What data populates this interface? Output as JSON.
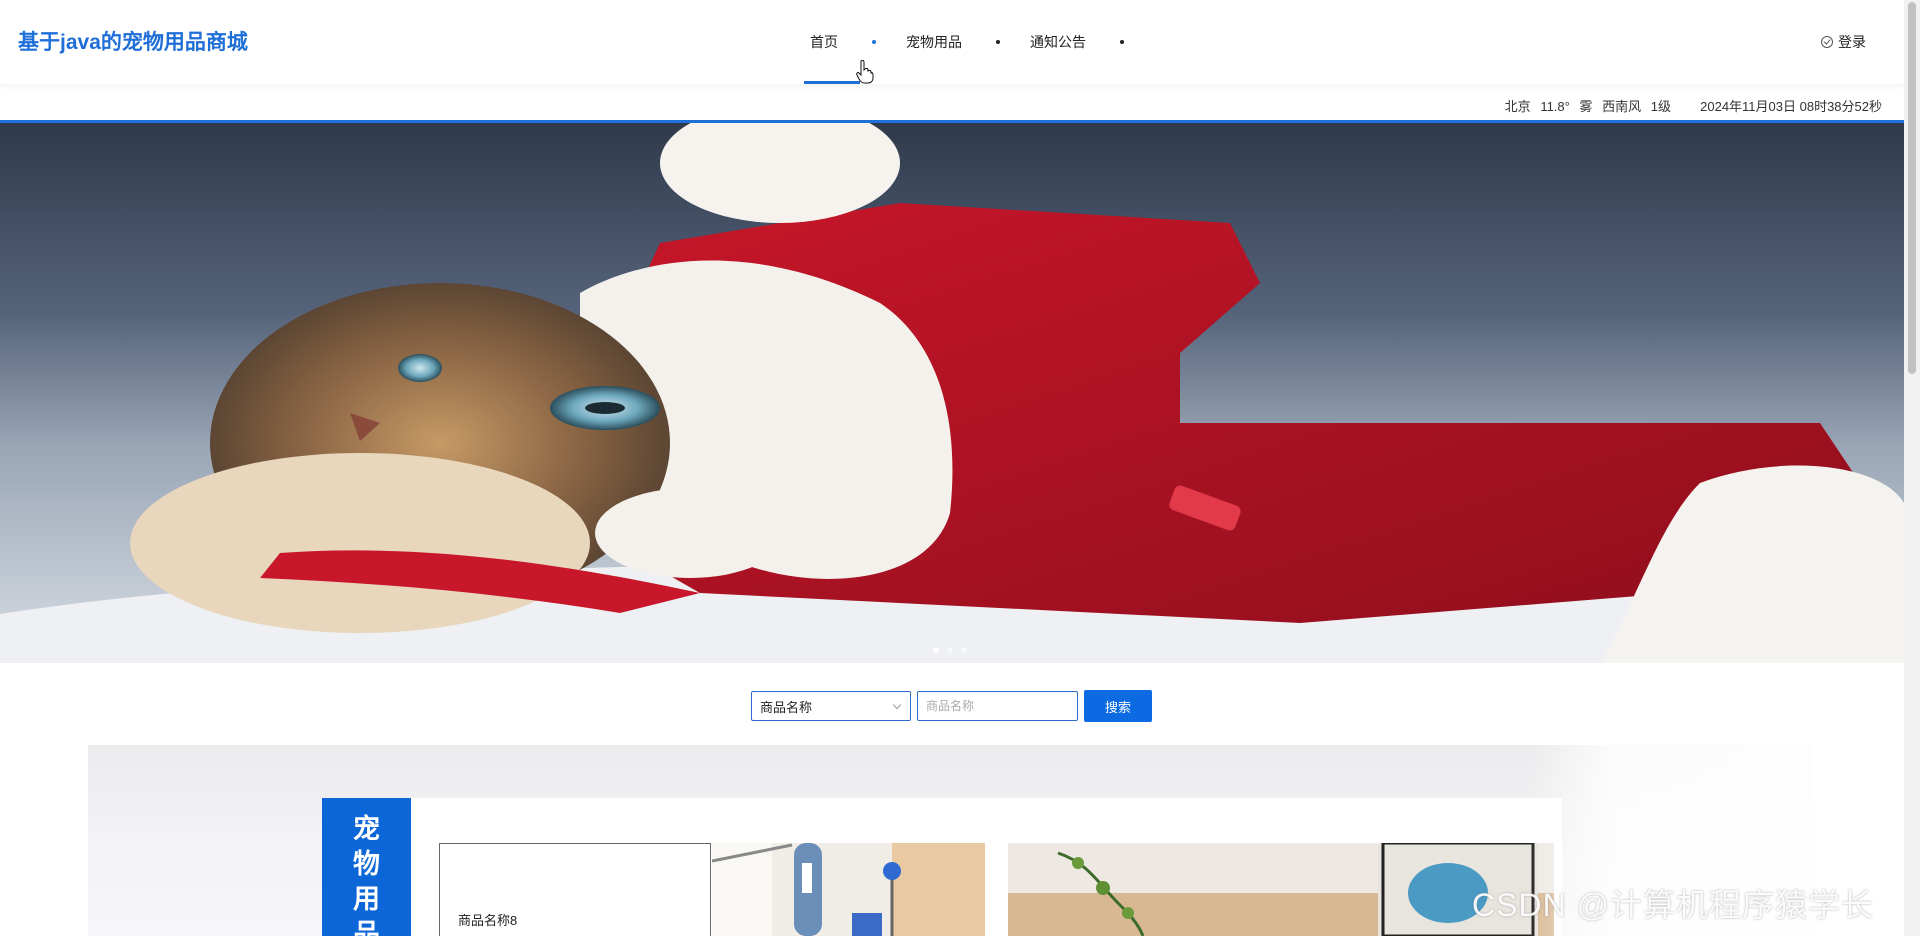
{
  "header": {
    "site_title": "基于java的宠物用品商城",
    "nav": [
      {
        "label": "首页",
        "active": true
      },
      {
        "label": "宠物用品",
        "active": false
      },
      {
        "label": "通知公告",
        "active": false
      }
    ],
    "login_label": "登录"
  },
  "infobar": {
    "city": "北京",
    "temperature": "11.8°",
    "condition": "雾",
    "wind": "西南风",
    "wind_level": "1级",
    "datetime": "2024年11月03日 08时38分52秒"
  },
  "banner": {
    "slide_count": 3,
    "active_slide": 1
  },
  "search": {
    "field_select": "商品名称",
    "placeholder": "商品名称",
    "value": "",
    "button_label": "搜索"
  },
  "products_section": {
    "category_title_chars": [
      "宠",
      "物",
      "用",
      "品"
    ],
    "items": [
      {
        "name": "商品名称8"
      }
    ]
  },
  "watermark": "CSDN @计算机程序猿学长",
  "colors": {
    "accent": "#1f6fd8",
    "button": "#0c6ae2"
  }
}
